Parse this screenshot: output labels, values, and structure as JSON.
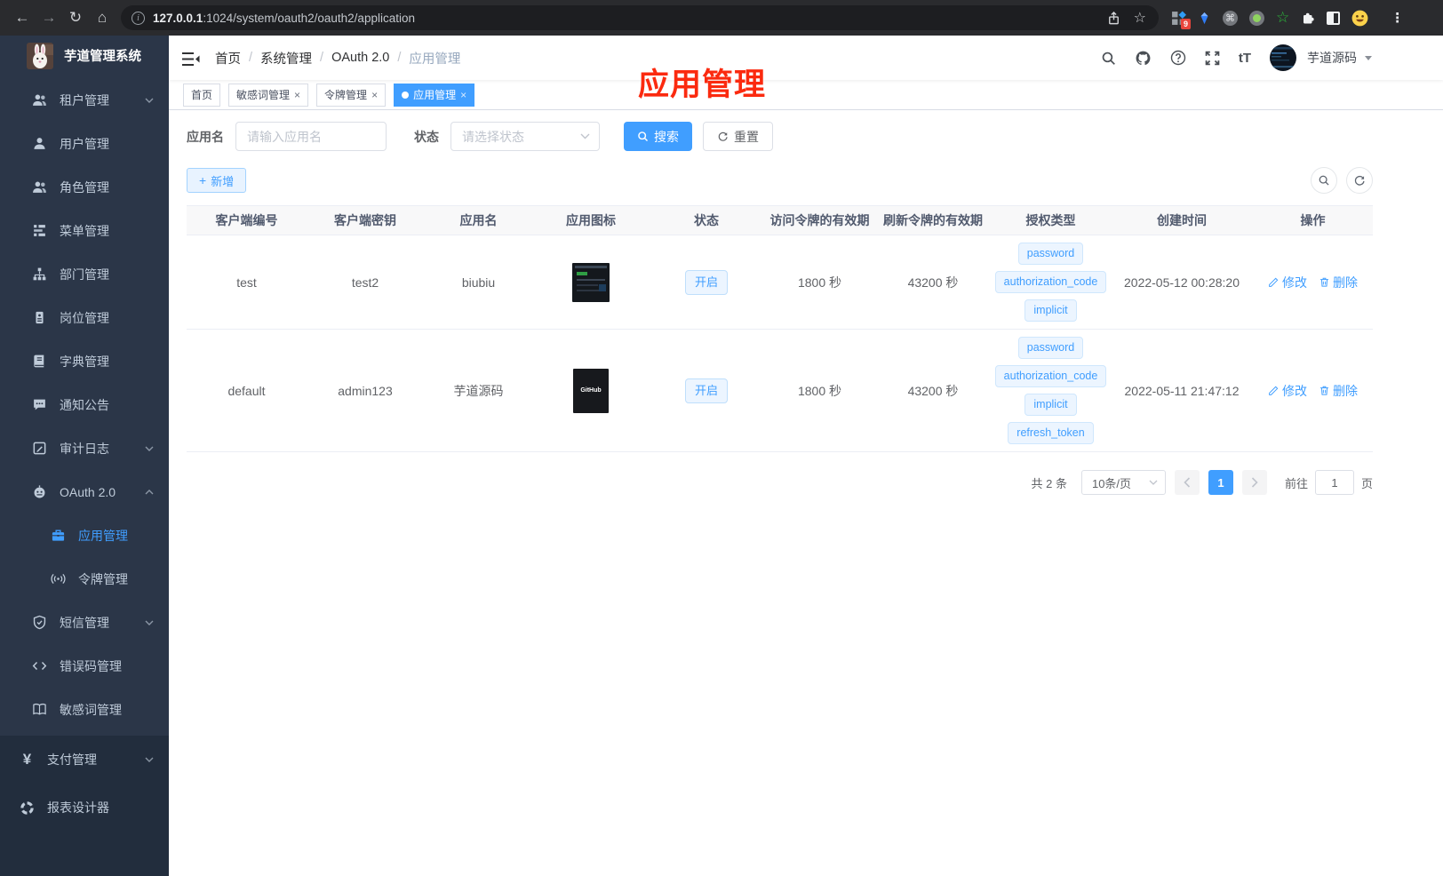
{
  "browser": {
    "url_host": "127.0.0.1",
    "url_rest": ":1024/system/oauth2/oauth2/application",
    "ext_badge": "9"
  },
  "icons": {
    "back": "←",
    "forward": "→",
    "reload": "↻",
    "home": "⌂",
    "info": "i",
    "star": "☆",
    "kebab": "⋮",
    "command": "⌘",
    "plus": "+",
    "yen": "¥",
    "font_size": "tT",
    "close": "×"
  },
  "sidebar": {
    "title": "芋道管理系统",
    "items": [
      {
        "label": "租户管理"
      },
      {
        "label": "用户管理"
      },
      {
        "label": "角色管理"
      },
      {
        "label": "菜单管理"
      },
      {
        "label": "部门管理"
      },
      {
        "label": "岗位管理"
      },
      {
        "label": "字典管理"
      },
      {
        "label": "通知公告"
      },
      {
        "label": "审计日志"
      },
      {
        "label": "OAuth 2.0"
      },
      {
        "label": "应用管理"
      },
      {
        "label": "令牌管理"
      },
      {
        "label": "短信管理"
      },
      {
        "label": "错误码管理"
      },
      {
        "label": "敏感词管理"
      },
      {
        "label": "支付管理"
      },
      {
        "label": "报表设计器"
      }
    ]
  },
  "header": {
    "breadcrumb": [
      "首页",
      "系统管理",
      "OAuth 2.0",
      "应用管理"
    ],
    "user_name": "芋道源码"
  },
  "tabs": [
    {
      "label": "首页"
    },
    {
      "label": "敏感词管理"
    },
    {
      "label": "令牌管理"
    },
    {
      "label": "应用管理"
    }
  ],
  "annotation": "应用管理",
  "filters": {
    "name_label": "应用名",
    "name_placeholder": "请输入应用名",
    "status_label": "状态",
    "status_placeholder": "请选择状态",
    "search_label": "搜索",
    "reset_label": "重置"
  },
  "toolbar": {
    "add_label": "新增"
  },
  "table": {
    "headers": [
      "客户端编号",
      "客户端密钥",
      "应用名",
      "应用图标",
      "状态",
      "访问令牌的有效期",
      "刷新令牌的有效期",
      "授权类型",
      "创建时间",
      "操作"
    ],
    "ops": {
      "edit": "修改",
      "delete": "删除"
    },
    "rows": [
      {
        "client_id": "test",
        "client_secret": "test2",
        "app_name": "biubiu",
        "status": "开启",
        "access_token_ttl": "1800 秒",
        "refresh_token_ttl": "43200 秒",
        "grants": [
          "password",
          "authorization_code",
          "implicit"
        ],
        "created_at": "2022-05-12 00:28:20"
      },
      {
        "client_id": "default",
        "client_secret": "admin123",
        "app_name": "芋道源码",
        "status": "开启",
        "access_token_ttl": "1800 秒",
        "refresh_token_ttl": "43200 秒",
        "grants": [
          "password",
          "authorization_code",
          "implicit",
          "refresh_token"
        ],
        "created_at": "2022-05-11 21:47:12",
        "icon_text": "GitHub"
      }
    ]
  },
  "pagination": {
    "total": "共 2 条",
    "size": "10条/页",
    "page": "1",
    "goto_label": "前往",
    "goto_value": "1",
    "page_unit": "页"
  },
  "colors": {
    "accent": "#409eff",
    "annotation_red": "#fb2a0f",
    "sidebar_bg": "#222d3d",
    "sidebar_submenu_bg": "#2b3648",
    "tag_bg": "#ecf5ff",
    "table_header_bg": "#f8f8f9"
  }
}
